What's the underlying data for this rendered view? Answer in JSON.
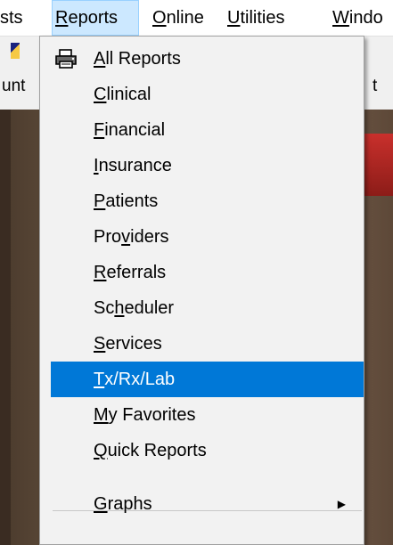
{
  "menubar": {
    "items": [
      {
        "label": "sts"
      },
      {
        "label": "Reports",
        "accel": "R",
        "rest": "eports"
      },
      {
        "label": "Online",
        "accel": "O",
        "rest": "nline"
      },
      {
        "label": "Utilities",
        "accel": "U",
        "rest": "tilities"
      },
      {
        "label": "Windo",
        "accel": "W",
        "rest": "indo"
      }
    ]
  },
  "toolbar": {
    "left_label": "unt",
    "right_label": "t"
  },
  "reports_menu": {
    "items": [
      {
        "pre": "",
        "accel": "A",
        "post": "ll Reports",
        "icon": "printer-icon"
      },
      {
        "pre": "",
        "accel": "C",
        "post": "linical"
      },
      {
        "pre": "",
        "accel": "F",
        "post": "inancial"
      },
      {
        "pre": "",
        "accel": "I",
        "post": "nsurance"
      },
      {
        "pre": "",
        "accel": "P",
        "post": "atients"
      },
      {
        "pre": "Pro",
        "accel": "v",
        "post": "iders"
      },
      {
        "pre": "",
        "accel": "R",
        "post": "eferrals"
      },
      {
        "pre": "Sc",
        "accel": "h",
        "post": "eduler"
      },
      {
        "pre": "",
        "accel": "S",
        "post": "ervices"
      },
      {
        "pre": "",
        "accel": "T",
        "post": "x/Rx/Lab",
        "selected": true
      },
      {
        "pre": "",
        "accel": "M",
        "post": "y Favorites"
      },
      {
        "pre": "",
        "accel": "Q",
        "post": "uick Reports"
      },
      {
        "pre": "",
        "accel": "G",
        "post": "raphs",
        "submenu": true
      }
    ],
    "submenu_arrow": "▶"
  },
  "colors": {
    "selection": "#0078d7",
    "menubar_active": "#cce8ff"
  }
}
